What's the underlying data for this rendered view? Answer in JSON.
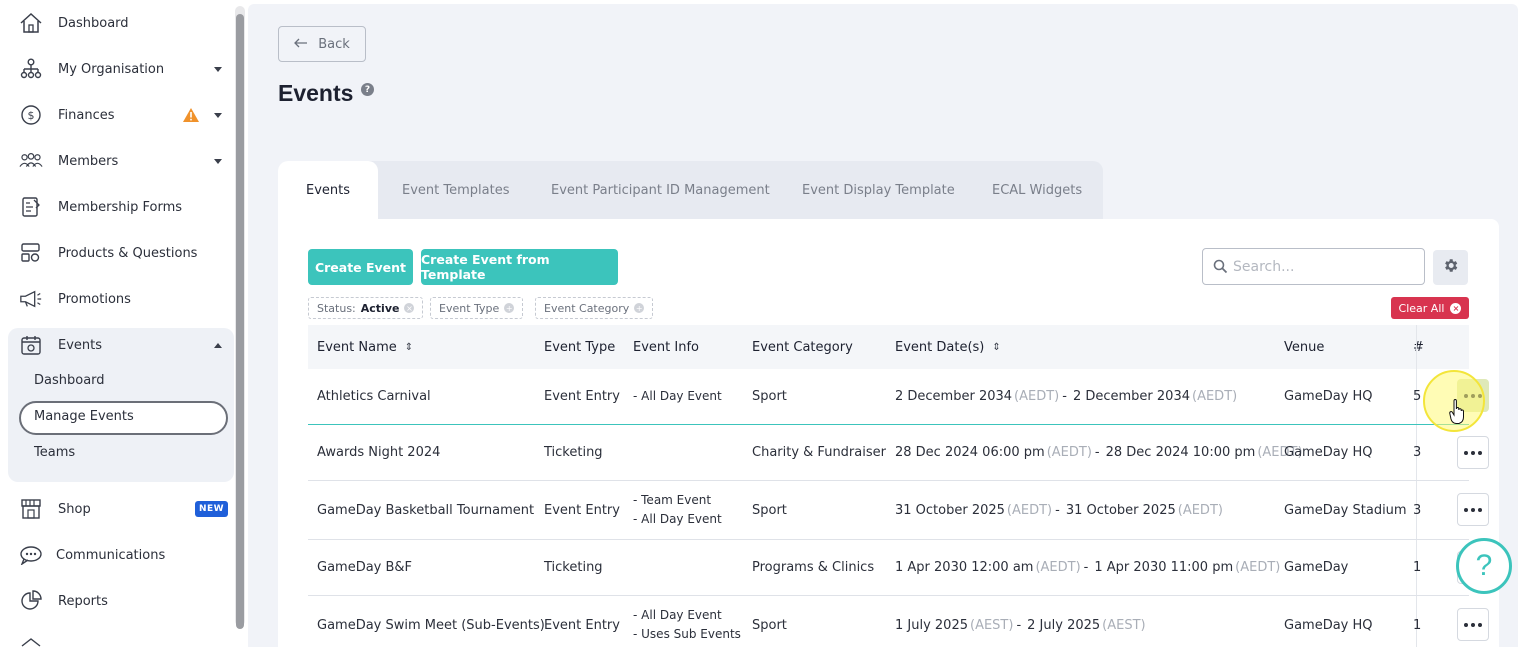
{
  "sidebar": {
    "items": [
      {
        "label": "Dashboard",
        "icon": "home-icon"
      },
      {
        "label": "My Organisation",
        "icon": "org-chart-icon"
      },
      {
        "label": "Finances",
        "icon": "dollar-circle-icon"
      },
      {
        "label": "Members",
        "icon": "people-icon"
      },
      {
        "label": "Membership Forms",
        "icon": "form-icon"
      },
      {
        "label": "Products & Questions",
        "icon": "products-icon"
      },
      {
        "label": "Promotions",
        "icon": "megaphone-icon"
      },
      {
        "label": "Events",
        "icon": "calendar-icon"
      },
      {
        "label": "Shop",
        "icon": "shop-icon"
      },
      {
        "label": "Communications",
        "icon": "chat-icon"
      },
      {
        "label": "Reports",
        "icon": "pie-chart-icon"
      }
    ],
    "events_sub": [
      "Dashboard",
      "Manage Events",
      "Teams"
    ],
    "shop_badge": "NEW",
    "warning_color": "#f0922b"
  },
  "back_label": "Back",
  "page_title": "Events",
  "tabs": [
    "Events",
    "Event Templates",
    "Event Participant ID Management",
    "Event Display Template",
    "ECAL Widgets"
  ],
  "toolbar": {
    "create_event": "Create Event",
    "create_from_template": "Create Event from Template",
    "search_placeholder": "Search..."
  },
  "filters": {
    "status_label": "Status:",
    "status_value": "Active",
    "event_type": "Event Type",
    "event_category": "Event Category",
    "clear_all": "Clear All"
  },
  "table": {
    "headers": {
      "name": "Event Name",
      "type": "Event Type",
      "info": "Event Info",
      "category": "Event Category",
      "dates": "Event Date(s)",
      "venue": "Venue",
      "clipped": "#"
    },
    "rows": [
      {
        "name": "Athletics Carnival",
        "type": "Event Entry",
        "info": [
          "- All Day Event"
        ],
        "category": "Sport",
        "start": "2 December 2034",
        "start_tz": "(AEDT)",
        "end": "2 December 2034",
        "end_tz": "(AEDT)",
        "venue": "GameDay HQ",
        "clipped": "5"
      },
      {
        "name": "Awards Night 2024",
        "type": "Ticketing",
        "info": [],
        "category": "Charity & Fundraiser",
        "start": "28 Dec 2024 06:00 pm",
        "start_tz": "(AEDT)",
        "end": "28 Dec 2024 10:00 pm",
        "end_tz": "(AEDT)",
        "venue": "GameDay HQ",
        "clipped": "3"
      },
      {
        "name": "GameDay Basketball Tournament",
        "type": "Event Entry",
        "info": [
          "- Team Event",
          "- All Day Event"
        ],
        "category": "Sport",
        "start": "31 October 2025",
        "start_tz": "(AEDT)",
        "end": "31 October 2025",
        "end_tz": "(AEDT)",
        "venue": "GameDay Stadium",
        "clipped": "3"
      },
      {
        "name": "GameDay B&F",
        "type": "Ticketing",
        "info": [],
        "category": "Programs & Clinics",
        "start": "1 Apr 2030 12:00 am",
        "start_tz": "(AEDT)",
        "end": "1 Apr 2030 11:00 pm",
        "end_tz": "(AEDT)",
        "venue": "GameDay",
        "clipped": "1"
      },
      {
        "name": "GameDay Swim Meet (Sub-Events)",
        "type": "Event Entry",
        "info": [
          "- All Day Event",
          "- Uses Sub Events"
        ],
        "category": "Sport",
        "start": "1 July 2025",
        "start_tz": "(AEST)",
        "end": "2 July 2025",
        "end_tz": "(AEST)",
        "venue": "GameDay HQ",
        "clipped": "1"
      }
    ]
  },
  "help_fab": "?",
  "colors": {
    "accent": "#3cc4bc",
    "danger": "#d8344f",
    "badge": "#1f5fd9"
  }
}
